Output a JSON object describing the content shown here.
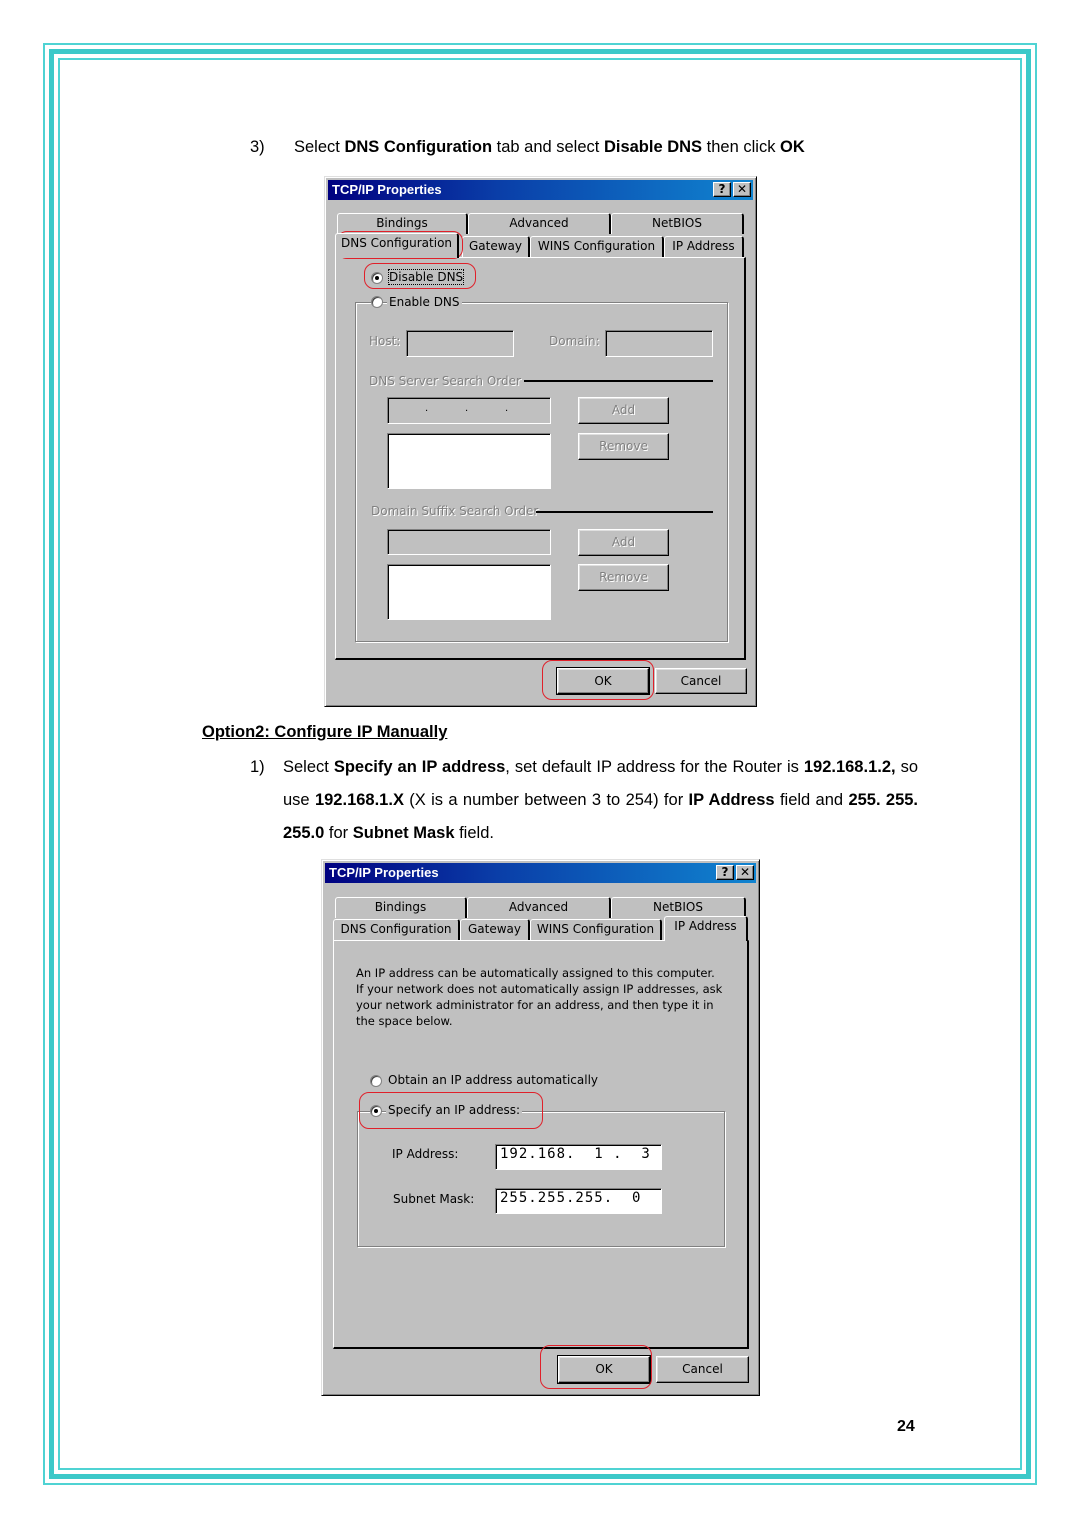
{
  "page": {
    "page_number": "24",
    "border_color": "#3cc9c9"
  },
  "step3": {
    "number": "3)",
    "parts": [
      "Select ",
      "DNS Configuration",
      " tab and select ",
      "Disable DNS",
      " then click ",
      "OK"
    ]
  },
  "dialog1": {
    "title": "TCP/IP Properties",
    "help_button": "?",
    "close_button": "✕",
    "tabs_back": [
      "Bindings",
      "Advanced",
      "NetBIOS"
    ],
    "tabs_front": [
      "DNS Configuration",
      "Gateway",
      "WINS Configuration",
      "IP Address"
    ],
    "active_tab": "DNS Configuration",
    "disable_dns_label": "Disable DNS",
    "enable_dns_label": "Enable DNS",
    "disable_dns_checked": true,
    "host_label": "Host:",
    "host_value": "",
    "domain_label": "Domain:",
    "domain_value": "",
    "dns_server_order_label": "DNS Server Search Order",
    "dns_ip_value": "",
    "ip_separator": ".",
    "add_label": "Add",
    "remove_label": "Remove",
    "domain_suffix_label": "Domain Suffix Search Order",
    "suffix_value": "",
    "ok_label": "OK",
    "cancel_label": "Cancel"
  },
  "option2": {
    "heading": "Option2: Configure IP Manually",
    "step_number": "1)",
    "parts": [
      "Select ",
      "Specify an IP address",
      ", set default IP address for the Router is ",
      "192.168.1.2,",
      " so use ",
      "192.168.1.X",
      " (X is a number between 3 to 254) for ",
      "IP Address",
      " field and ",
      "255. 255. 255.0",
      " for ",
      "Subnet Mask",
      " field."
    ]
  },
  "dialog2": {
    "title": "TCP/IP Properties",
    "help_button": "?",
    "close_button": "✕",
    "tabs_back": [
      "Bindings",
      "Advanced",
      "NetBIOS"
    ],
    "tabs_front": [
      "DNS Configuration",
      "Gateway",
      "WINS Configuration",
      "IP Address"
    ],
    "active_tab": "IP Address",
    "description": [
      "An IP address can be automatically assigned to this computer.",
      "If your network does not automatically assign IP addresses, ask",
      "your network administrator for an address, and then type it in",
      "the space below."
    ],
    "obtain_auto_label": "Obtain an IP address automatically",
    "specify_label": "Specify an IP address:",
    "specify_checked": true,
    "ip_address_label": "IP Address:",
    "ip_address_value": "192.168.  1 .  3",
    "subnet_mask_label": "Subnet Mask:",
    "subnet_mask_value": "255.255.255.  0",
    "ok_label": "OK",
    "cancel_label": "Cancel"
  }
}
